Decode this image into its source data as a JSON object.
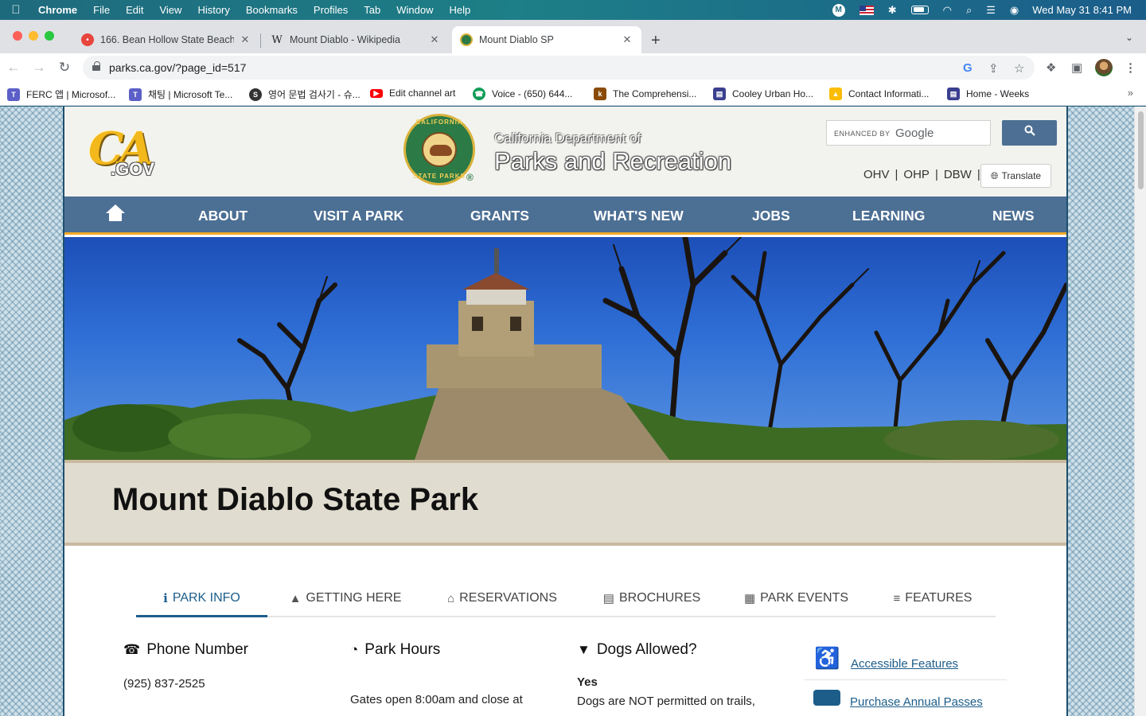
{
  "menubar": {
    "apple": "",
    "items": [
      "Chrome",
      "File",
      "Edit",
      "View",
      "History",
      "Bookmarks",
      "Profiles",
      "Tab",
      "Window",
      "Help"
    ],
    "clock": "Wed May 31  8:41 PM",
    "m_icon": "M"
  },
  "tabs": [
    {
      "title": "166. Bean Hollow State Beach,",
      "favicon": "pin-icon",
      "color": "#e8453c"
    },
    {
      "title": "Mount Diablo - Wikipedia",
      "favicon": "W"
    },
    {
      "title": "Mount Diablo SP",
      "favicon": "ca-parks-icon",
      "active": true
    }
  ],
  "omnibox": {
    "url": "parks.ca.gov/?page_id=517"
  },
  "bookmarks": [
    {
      "label": "FERC 앱 | Microsof...",
      "color": "#5b5fc7"
    },
    {
      "label": "채팅 | Microsoft Te...",
      "color": "#5b5fc7"
    },
    {
      "label": "영어 문법 검사기 - 슈...",
      "color": "#333333"
    },
    {
      "label": "Edit channel art",
      "color": "#ff0000"
    },
    {
      "label": "Voice - (650) 644...",
      "color": "#0f9d58"
    },
    {
      "label": "The Comprehensi...",
      "color": "#8a4b08"
    },
    {
      "label": "Cooley Urban Ho...",
      "color": "#3b3f8f"
    },
    {
      "label": "Contact Informati...",
      "color": "#fbbc04"
    },
    {
      "label": "Home - Weeks",
      "color": "#3b3f8f"
    }
  ],
  "site": {
    "logo": {
      "ca": "CA",
      "gov": ".GOV"
    },
    "seal": {
      "top": "CALIFORNIA",
      "bottom": "STATE PARKS",
      "reg": "®"
    },
    "dept_line1": "California Department of",
    "dept_line2": "Parks and Recreation",
    "search": {
      "enhanced_by": "ENHANCED BY",
      "google": "Google",
      "button_icon": "search-icon"
    },
    "header_links": [
      "OHV",
      "|",
      "OHP",
      "|",
      "DBW",
      "|"
    ],
    "translate": "Translate",
    "nav": [
      "ABOUT",
      "VISIT A PARK",
      "GRANTS",
      "WHAT'S NEW",
      "JOBS",
      "LEARNING",
      "NEWS"
    ],
    "park_name_bold": "Mount Diablo",
    "park_name_rest": " State Park",
    "park_tabs": [
      {
        "label": "PARK INFO",
        "icon": "info-icon",
        "active": true
      },
      {
        "label": "GETTING HERE",
        "icon": "car-icon"
      },
      {
        "label": "RESERVATIONS",
        "icon": "home-icon"
      },
      {
        "label": "BROCHURES",
        "icon": "book-icon"
      },
      {
        "label": "PARK EVENTS",
        "icon": "calendar-icon"
      },
      {
        "label": "FEATURES",
        "icon": "sliders-icon"
      }
    ],
    "phone": {
      "heading": "Phone Number",
      "value": "(925) 837-2525"
    },
    "hours": {
      "heading": "Park Hours",
      "text": "Gates open 8:00am and close at"
    },
    "dogs": {
      "heading": "Dogs Allowed?",
      "answer": "Yes",
      "text": "Dogs are NOT permitted on trails,"
    },
    "side_links": [
      "Accessible Features",
      "Purchase Annual Passes"
    ]
  }
}
